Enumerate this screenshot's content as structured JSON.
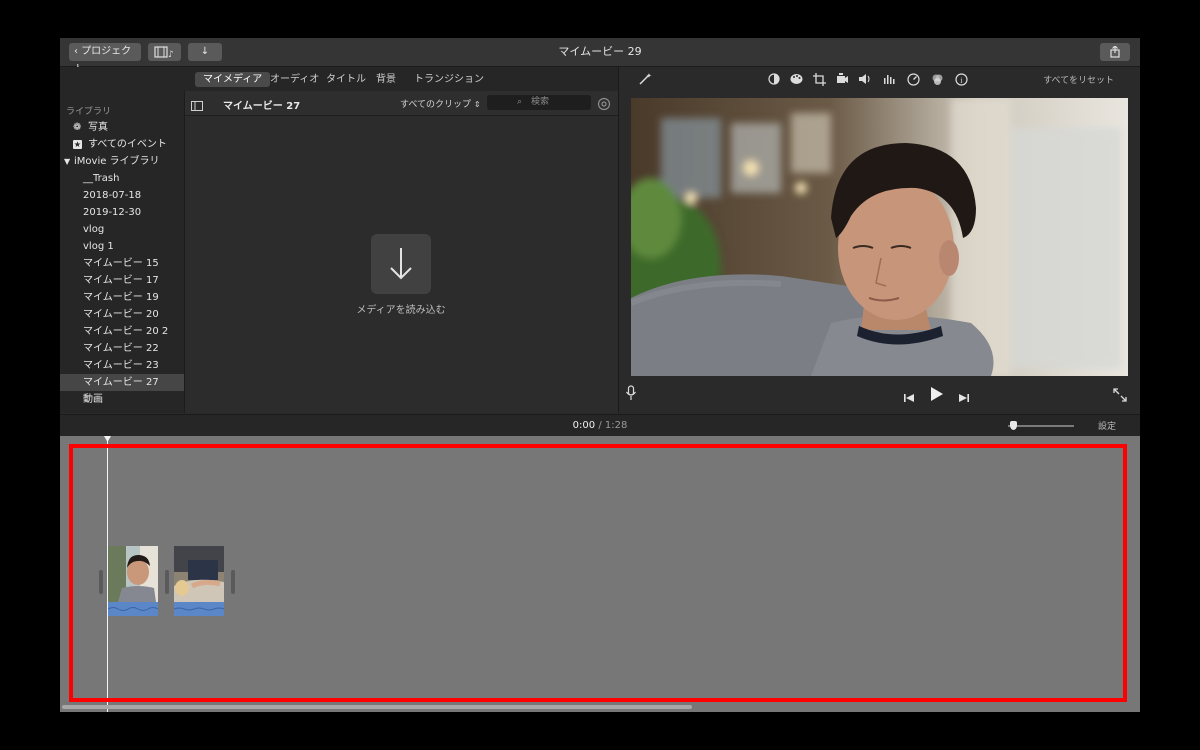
{
  "window": {
    "title": "マイムービー 29",
    "back_label": "プロジェクト"
  },
  "tabs": [
    {
      "label": "マイメディア",
      "active": true
    },
    {
      "label": "オーディオ",
      "active": false
    },
    {
      "label": "タイトル",
      "active": false
    },
    {
      "label": "背景",
      "active": false
    },
    {
      "label": "トランジション",
      "active": false
    }
  ],
  "sidebar": {
    "heading": "ライブラリ",
    "photos": "写真",
    "all_events": "すべてのイベント",
    "library": "iMovie ライブラリ",
    "items": [
      "__Trash",
      "2018-07-18",
      "2019-12-30",
      "vlog",
      "vlog 1",
      "マイムービー 15",
      "マイムービー 17",
      "マイムービー 19",
      "マイムービー 20",
      "マイムービー 20 2",
      "マイムービー 22",
      "マイムービー 23",
      "マイムービー 27",
      "動画"
    ],
    "selected_item": "マイムービー 27"
  },
  "browser": {
    "event_title": "マイムービー 27",
    "filter": "すべてのクリップ",
    "search_placeholder": "検索",
    "import_label": "メディアを読み込む"
  },
  "viewer": {
    "reset_label": "すべてをリセット",
    "toolbar_icons": [
      "color-balance-icon",
      "color-palette-icon",
      "crop-icon",
      "stabilization-icon",
      "volume-icon",
      "equalizer-icon",
      "speed-icon",
      "filter-icon",
      "info-icon"
    ]
  },
  "timeline": {
    "current_time": "0:00",
    "separator": "/",
    "total_time": "1:28",
    "settings_label": "設定",
    "zoom_level": 0.08,
    "clips": [
      {
        "name": "clip-1"
      },
      {
        "name": "clip-2"
      }
    ]
  },
  "colors": {
    "highlight": "#ff0000",
    "timeline_bg": "#777777",
    "audio_wave": "#5b86c8"
  }
}
